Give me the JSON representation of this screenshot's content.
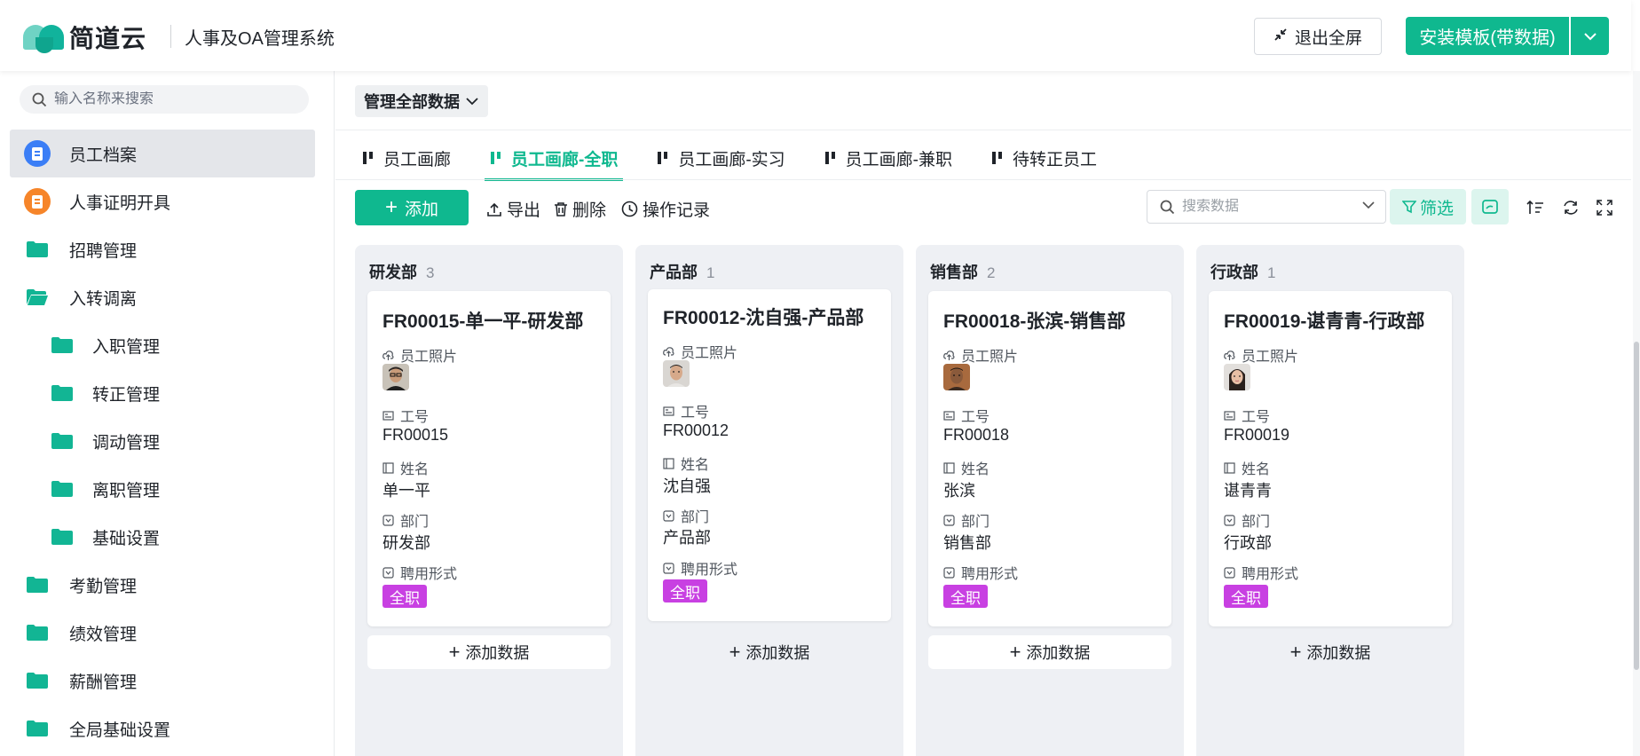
{
  "header": {
    "logo_text": "简道云",
    "app_name": "人事及OA管理系统",
    "exit_fullscreen": "退出全屏",
    "install_button": "安装模板(带数据)"
  },
  "sidebar": {
    "search_placeholder": "输入名称来搜索",
    "items": [
      {
        "label": "员工档案",
        "icon": "blue-doc-icon",
        "active": true
      },
      {
        "label": "人事证明开具",
        "icon": "orange-doc-icon"
      },
      {
        "label": "招聘管理",
        "icon": "folder-icon"
      },
      {
        "label": "入转调离",
        "icon": "folder-open-icon"
      },
      {
        "label": "入职管理",
        "icon": "folder-icon",
        "sub": true
      },
      {
        "label": "转正管理",
        "icon": "folder-icon",
        "sub": true
      },
      {
        "label": "调动管理",
        "icon": "folder-icon",
        "sub": true
      },
      {
        "label": "离职管理",
        "icon": "folder-icon",
        "sub": true
      },
      {
        "label": "基础设置",
        "icon": "folder-icon",
        "sub": true
      },
      {
        "label": "考勤管理",
        "icon": "folder-icon"
      },
      {
        "label": "绩效管理",
        "icon": "folder-icon"
      },
      {
        "label": "薪酬管理",
        "icon": "folder-icon"
      },
      {
        "label": "全局基础设置",
        "icon": "folder-icon"
      }
    ]
  },
  "main": {
    "scope": "管理全部数据",
    "tabs": [
      {
        "label": "员工画廊"
      },
      {
        "label": "员工画廊-全职",
        "active": true
      },
      {
        "label": "员工画廊-实习"
      },
      {
        "label": "员工画廊-兼职"
      },
      {
        "label": "待转正员工"
      }
    ],
    "toolbar": {
      "add": "添加",
      "export": "导出",
      "delete": "删除",
      "history": "操作记录",
      "search_placeholder": "搜索数据",
      "filter": "筛选"
    },
    "field_labels": {
      "photo": "员工照片",
      "id": "工号",
      "name": "姓名",
      "dept": "部门",
      "type": "聘用形式"
    },
    "add_data": "添加数据",
    "columns": [
      {
        "name": "研发部",
        "count": "3",
        "card": {
          "title": "FR00015-单一平-研发部",
          "id": "FR00015",
          "name": "单一平",
          "dept": "研发部",
          "type": "全职"
        }
      },
      {
        "name": "产品部",
        "count": "1",
        "card": {
          "title": "FR00012-沈自强-产品部",
          "id": "FR00012",
          "name": "沈自强",
          "dept": "产品部",
          "type": "全职"
        }
      },
      {
        "name": "销售部",
        "count": "2",
        "card": {
          "title": "FR00018-张滨-销售部",
          "id": "FR00018",
          "name": "张滨",
          "dept": "销售部",
          "type": "全职"
        }
      },
      {
        "name": "行政部",
        "count": "1",
        "card": {
          "title": "FR00019-谌青青-行政部",
          "id": "FR00019",
          "name": "谌青青",
          "dept": "行政部",
          "type": "全职"
        }
      }
    ]
  },
  "colors": {
    "accent": "#0fb88f",
    "tag": "#c840e2",
    "folder": "#12b594"
  }
}
